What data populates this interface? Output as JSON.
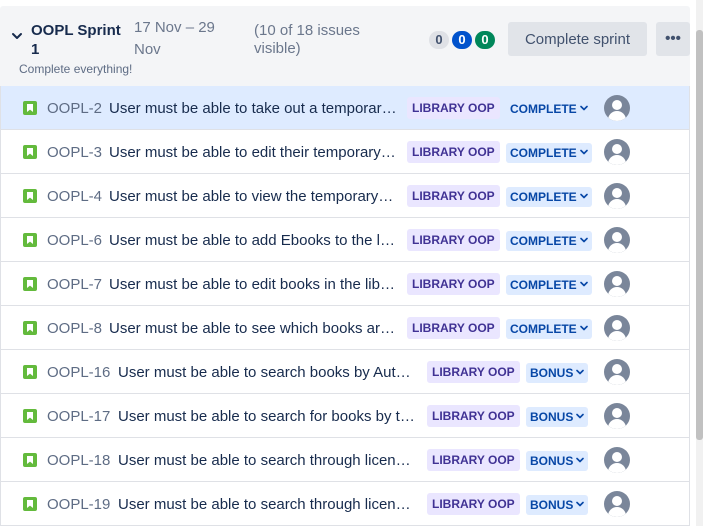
{
  "sprint": {
    "name": "OOPL Sprint 1",
    "dates": "17 Nov – 29 Nov",
    "visible_issues": "(10 of 18 issues visible)",
    "goal": "Complete everything!",
    "counts": {
      "todo": "0",
      "in_progress": "0",
      "done": "0"
    },
    "complete_button": "Complete sprint",
    "more_button": "•••"
  },
  "issues": [
    {
      "key": "OOPL-2",
      "summary": "User must be able to take out a temporary loan",
      "epic": "LIBRARY OOP",
      "status": "COMPLETE"
    },
    {
      "key": "OOPL-3",
      "summary": "User must be able to edit their temporary loan",
      "epic": "LIBRARY OOP",
      "status": "COMPLETE"
    },
    {
      "key": "OOPL-4",
      "summary": "User must be able to view the temporary loans",
      "epic": "LIBRARY OOP",
      "status": "COMPLETE"
    },
    {
      "key": "OOPL-6",
      "summary": "User must be able to add Ebooks to the library",
      "epic": "LIBRARY OOP",
      "status": "COMPLETE"
    },
    {
      "key": "OOPL-7",
      "summary": "User must be able to edit books in the library",
      "epic": "LIBRARY OOP",
      "status": "COMPLETE"
    },
    {
      "key": "OOPL-8",
      "summary": "User must be able to see which books are loaned",
      "epic": "LIBRARY OOP",
      "status": "COMPLETE"
    },
    {
      "key": "OOPL-16",
      "summary": "User must be able to search books by Author",
      "epic": "LIBRARY OOP",
      "status": "BONUS"
    },
    {
      "key": "OOPL-17",
      "summary": "User must be able to search for books by title",
      "epic": "LIBRARY OOP",
      "status": "BONUS"
    },
    {
      "key": "OOPL-18",
      "summary": "User must be able to search through licenses",
      "epic": "LIBRARY OOP",
      "status": "BONUS"
    },
    {
      "key": "OOPL-19",
      "summary": "User must be able to search through licenses",
      "epic": "LIBRARY OOP",
      "status": "BONUS"
    }
  ],
  "colors": {
    "selected_row": "#deebff",
    "story_icon": "#63ba3c",
    "epic_bg": "#eae6ff",
    "epic_text": "#403294",
    "status_bg": "#deebff",
    "status_text": "#0747a6"
  },
  "icons": {
    "chevron": "chevron-down-icon",
    "issue_type": "story-icon",
    "status_caret": "chevron-down-icon",
    "assignee": "avatar-default-icon"
  }
}
